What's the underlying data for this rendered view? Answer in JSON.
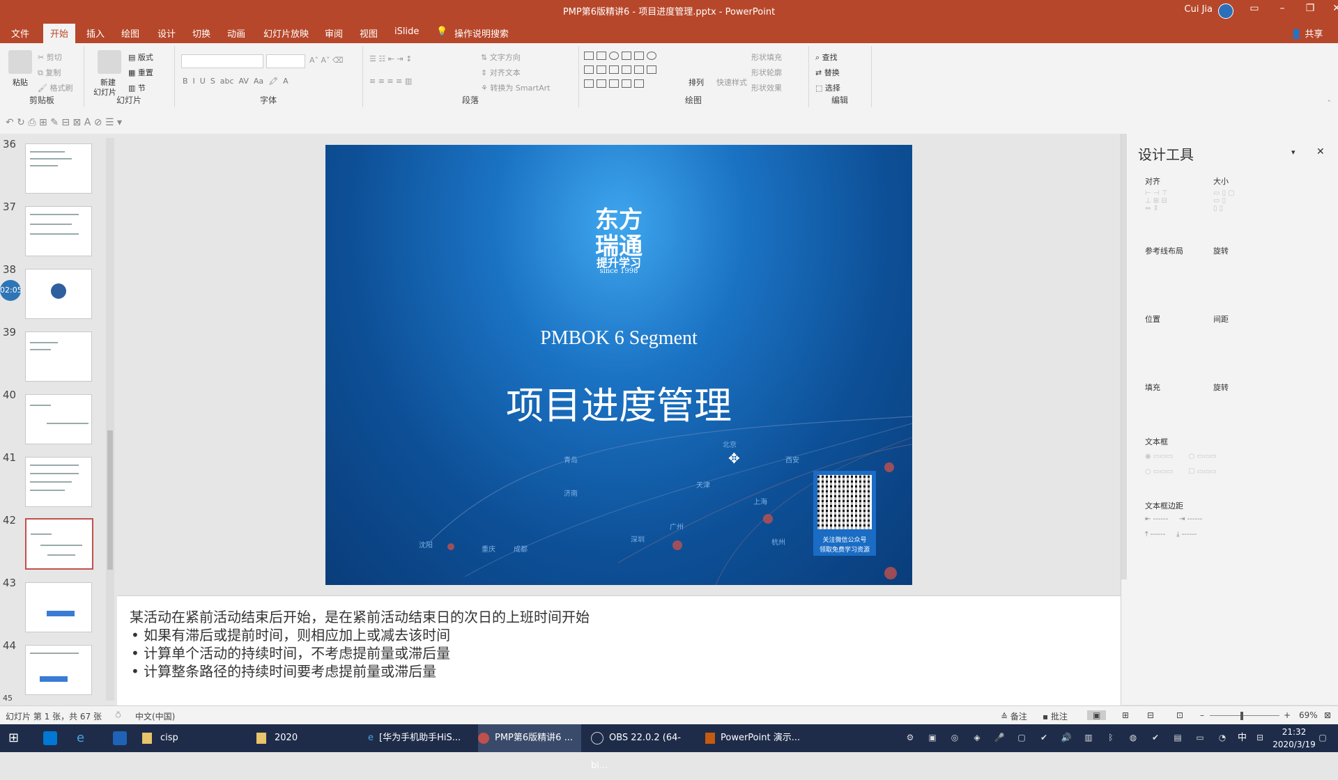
{
  "window": {
    "title": "PMP第6版精讲6 - 项目进度管理.pptx - PowerPoint",
    "user": "Cui Jia",
    "share": "共享"
  },
  "tabs": [
    "文件",
    "开始",
    "插入",
    "绘图",
    "设计",
    "切换",
    "动画",
    "幻灯片放映",
    "审阅",
    "视图",
    "iSlide",
    "操作说明搜索"
  ],
  "ribbon": {
    "clipboard": {
      "label": "剪贴板",
      "paste": "粘贴",
      "cut": "剪切",
      "copy": "复制",
      "format": "格式刷"
    },
    "slides": {
      "label": "幻灯片",
      "new": "新建",
      "new2": "幻灯片",
      "layout": "版式",
      "reset": "重置",
      "section": "节"
    },
    "font": {
      "label": "字体"
    },
    "paragraph": {
      "label": "段落",
      "direction": "文字方向",
      "align": "对齐文本",
      "smartart": "转换为 SmartArt"
    },
    "drawing": {
      "label": "绘图",
      "arrange": "排列",
      "quickstyle": "快速样式",
      "fill": "形状填充",
      "outline": "形状轮廓",
      "effect": "形状效果"
    },
    "editing": {
      "label": "编辑",
      "find": "查找",
      "replace": "替换",
      "select": "选择"
    }
  },
  "thumbnails": [
    {
      "num": "36"
    },
    {
      "num": "37"
    },
    {
      "num": "38"
    },
    {
      "num": "39"
    },
    {
      "num": "40"
    },
    {
      "num": "41"
    },
    {
      "num": "42"
    },
    {
      "num": "43"
    },
    {
      "num": "44"
    },
    {
      "num": "45"
    }
  ],
  "timer_badge": "02:05",
  "slide": {
    "logo_line1": "东方",
    "logo_line2": "瑞通",
    "logo_line3": "提升学习",
    "logo_line4": "since 1998",
    "subtitle": "PMBOK 6 Segment",
    "title": "项目进度管理",
    "qr_caption1": "关注微信公众号",
    "qr_caption2": "领取免费学习资源",
    "cities": [
      "青岛",
      "北京",
      "天津",
      "济南",
      "沈阳",
      "重庆",
      "成都",
      "深圳",
      "广州",
      "上海",
      "杭州",
      "西安"
    ]
  },
  "notes": [
    "某活动在紧前活动结束后开始，是在紧前活动结束日的次日的上班时间开始",
    "• 如果有滞后或提前时间，则相应加上或减去该时间",
    "• 计算单个活动的持续时间，不考虑提前量或滞后量",
    "• 计算整条路径的持续时间要考虑提前量或滞后量"
  ],
  "design_pane": {
    "title": "设计工具",
    "align": "对齐",
    "size": "大小",
    "ref": "参考线布局",
    "distribute": "旋转",
    "pos": "位置",
    "spacing": "间距",
    "fill": "填充",
    "rotate": "旋转",
    "textbox": "文本框",
    "margins": "文本框边距"
  },
  "status": {
    "slide_info": "幻灯片 第 1 张，共 67 张",
    "language": "中文(中国)",
    "notes": "备注",
    "comments": "批注",
    "zoom": "69%"
  },
  "taskbar": {
    "items": [
      "cisp",
      "2020",
      "[华为手机助手HiS...",
      "PMP第6版精讲6 ...",
      "OBS 22.0.2 (64-bi...",
      "PowerPoint 演示..."
    ],
    "time": "21:32",
    "date": "2020/3/19",
    "ime": "中"
  },
  "colors": {
    "accent": "#b7472a",
    "taskbar": "#1e2c4a",
    "slide_blue": "#1b73c4"
  }
}
